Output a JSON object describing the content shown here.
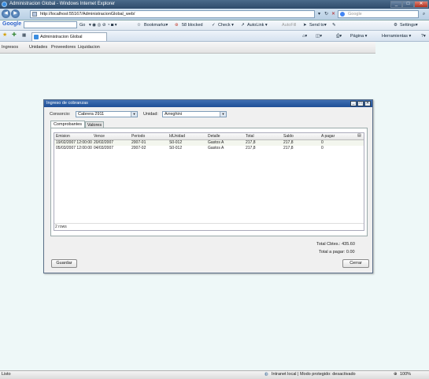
{
  "window": {
    "title": "Administracion Global - Windows Internet Explorer",
    "min_label": "_",
    "max_label": "□",
    "close_label": "✕"
  },
  "address": {
    "url": "http://localhost:55167/AdministracionGlobal_web/",
    "search_placeholder": "Google",
    "refresh_label": "↻",
    "stop_label": "✕"
  },
  "google_toolbar": {
    "logo": "Google",
    "go_label": "Go",
    "bookmarks_label": "Bookmarks▾",
    "blocked_label": "58 blocked",
    "check_label": "Check ▾",
    "autolink_label": "AutoLink ▾",
    "autofill_label": "AutoFill",
    "sendto_label": "Send to▾",
    "settings_label": "Settings▾"
  },
  "tabs_bar": {
    "tab_title": "Administracion Global",
    "page_label": "Página ▾",
    "tools_label": "Herramientas ▾"
  },
  "app_menu": {
    "items": [
      "Ingresos",
      "Unidades",
      "Proveedores",
      "Liquidacion"
    ]
  },
  "dialog": {
    "title": "Ingreso de cobranzas",
    "consorcio_label": "Consorcio:",
    "consorcio_value": "Cabrera 2911",
    "unidad_label": "Unidad:",
    "unidad_value": "Arreghini",
    "tabs": [
      "Comprobantes",
      "Valores"
    ],
    "columns": [
      "Emision",
      "Vence",
      "Periodo",
      "IdUnidad",
      "Detalle",
      "Total",
      "Saldo",
      "A pagar"
    ],
    "rows": [
      [
        "19/02/2007 12:00:00",
        "20/02/2007",
        "2007-01",
        "S0-012",
        "Gastos A",
        "217,8",
        "217,8",
        "0"
      ],
      [
        "05/03/2007 12:00:00",
        "04/03/2007",
        "2007-02",
        "S0-012",
        "Gastos A",
        "217,8",
        "217,8",
        "0"
      ]
    ],
    "row_count": "2 rows",
    "total_cbtes": "Total Cbtes.: 435.60",
    "total_pagar": "Total a pagar: 0.00",
    "save_label": "Guardar",
    "close_label": "Cerrar"
  },
  "status": {
    "left": "Listo",
    "zone": "Intranet local | Modo protegido: desactivado",
    "zoom": "100%"
  }
}
